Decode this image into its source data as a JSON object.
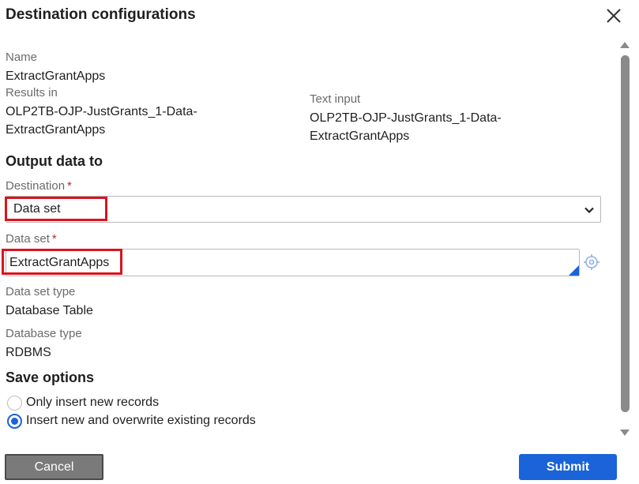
{
  "dialog": {
    "title": "Destination configurations"
  },
  "info": {
    "name_label": "Name",
    "name_value": "ExtractGrantApps",
    "results_in_label": "Results in",
    "results_in_value_line1": "OLP2TB-OJP-JustGrants_1-Data-",
    "results_in_value_line2": "ExtractGrantApps",
    "text_input_label": "Text input",
    "text_input_value_line1": "OLP2TB-OJP-JustGrants_1-Data-",
    "text_input_value_line2": "ExtractGrantApps"
  },
  "output": {
    "section_title": "Output data to",
    "destination_label": "Destination",
    "destination_value": "Data set",
    "required_marker": "*",
    "data_set_label": "Data set",
    "data_set_value": "ExtractGrantApps",
    "data_set_type_label": "Data set type",
    "data_set_type_value": "Database Table",
    "database_type_label": "Database type",
    "database_type_value": "RDBMS"
  },
  "save_options": {
    "section_title": "Save options",
    "options": [
      {
        "label": "Only insert new records",
        "checked": false
      },
      {
        "label": "Insert new and overwrite existing records",
        "checked": true
      }
    ]
  },
  "footer": {
    "cancel_label": "Cancel",
    "submit_label": "Submit"
  },
  "icons": {
    "close": "close-icon",
    "chevron": "chevron-down-icon",
    "target": "crosshair-target-icon"
  },
  "colors": {
    "accent": "#1a63d8",
    "highlight": "#d9141e",
    "required": "#c0262d",
    "cancel_bg": "#7a7a7a"
  }
}
